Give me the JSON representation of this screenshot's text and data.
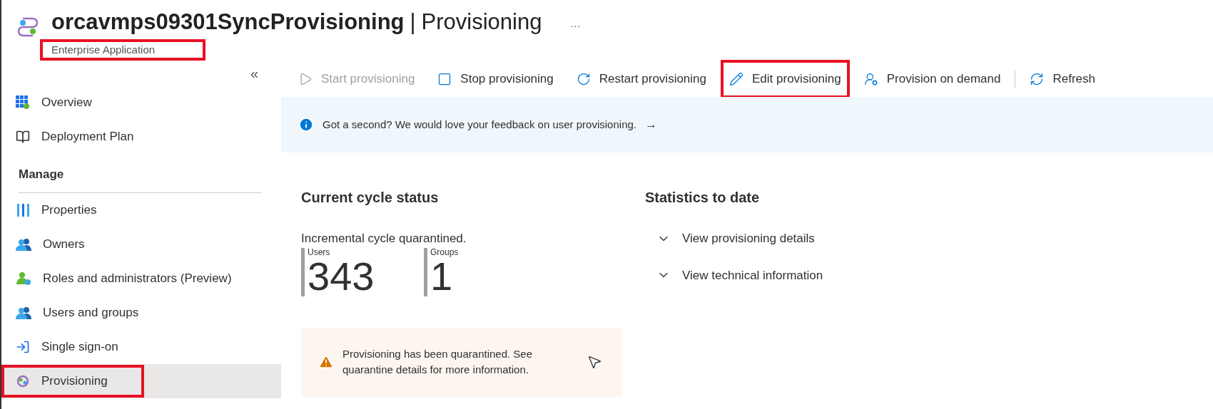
{
  "header": {
    "title": "orcavmps09301SyncProvisioning",
    "separator": "|",
    "page": "Provisioning",
    "more": "···",
    "subtitle": {
      "text": "Enterprise Application",
      "highlighted": true
    }
  },
  "sidebar": {
    "collapse": "«",
    "items": [
      {
        "kind": "item",
        "label": "Overview",
        "selected": false,
        "highlighted": false
      },
      {
        "kind": "item",
        "label": "Deployment Plan",
        "selected": false,
        "highlighted": false
      },
      {
        "kind": "section",
        "label": "Manage"
      },
      {
        "kind": "item",
        "label": "Properties",
        "selected": false,
        "highlighted": false
      },
      {
        "kind": "item",
        "label": "Owners",
        "selected": false,
        "highlighted": false
      },
      {
        "kind": "item",
        "label": "Roles and administrators (Preview)",
        "selected": false,
        "highlighted": false
      },
      {
        "kind": "item",
        "label": "Users and groups",
        "selected": false,
        "highlighted": false
      },
      {
        "kind": "item",
        "label": "Single sign-on",
        "selected": false,
        "highlighted": false
      },
      {
        "kind": "item",
        "label": "Provisioning",
        "selected": true,
        "highlighted": true
      }
    ]
  },
  "toolbar": [
    {
      "label": "Start provisioning",
      "disabled": true,
      "highlighted": false,
      "divider_before": false
    },
    {
      "label": "Stop provisioning",
      "disabled": false,
      "highlighted": false,
      "divider_before": false
    },
    {
      "label": "Restart provisioning",
      "disabled": false,
      "highlighted": false,
      "divider_before": false
    },
    {
      "label": "Edit provisioning",
      "disabled": false,
      "highlighted": true,
      "divider_before": false
    },
    {
      "label": "Provision on demand",
      "disabled": false,
      "highlighted": false,
      "divider_before": false
    },
    {
      "label": "Refresh",
      "disabled": false,
      "highlighted": false,
      "divider_before": true
    }
  ],
  "banner": {
    "text": "Got a second? We would love your feedback on user provisioning.",
    "arrow": "→"
  },
  "current_cycle": {
    "heading": "Current cycle status",
    "status": "Incremental cycle quarantined.",
    "stats": [
      {
        "label": "Users",
        "value": "343"
      },
      {
        "label": "Groups",
        "value": "1"
      }
    ],
    "warning": "Provisioning has been quarantined. See quarantine details for more information."
  },
  "statistics": {
    "heading": "Statistics to date",
    "sections": [
      {
        "label": "View provisioning details",
        "expanded": false
      },
      {
        "label": "View technical information",
        "expanded": false
      }
    ]
  }
}
